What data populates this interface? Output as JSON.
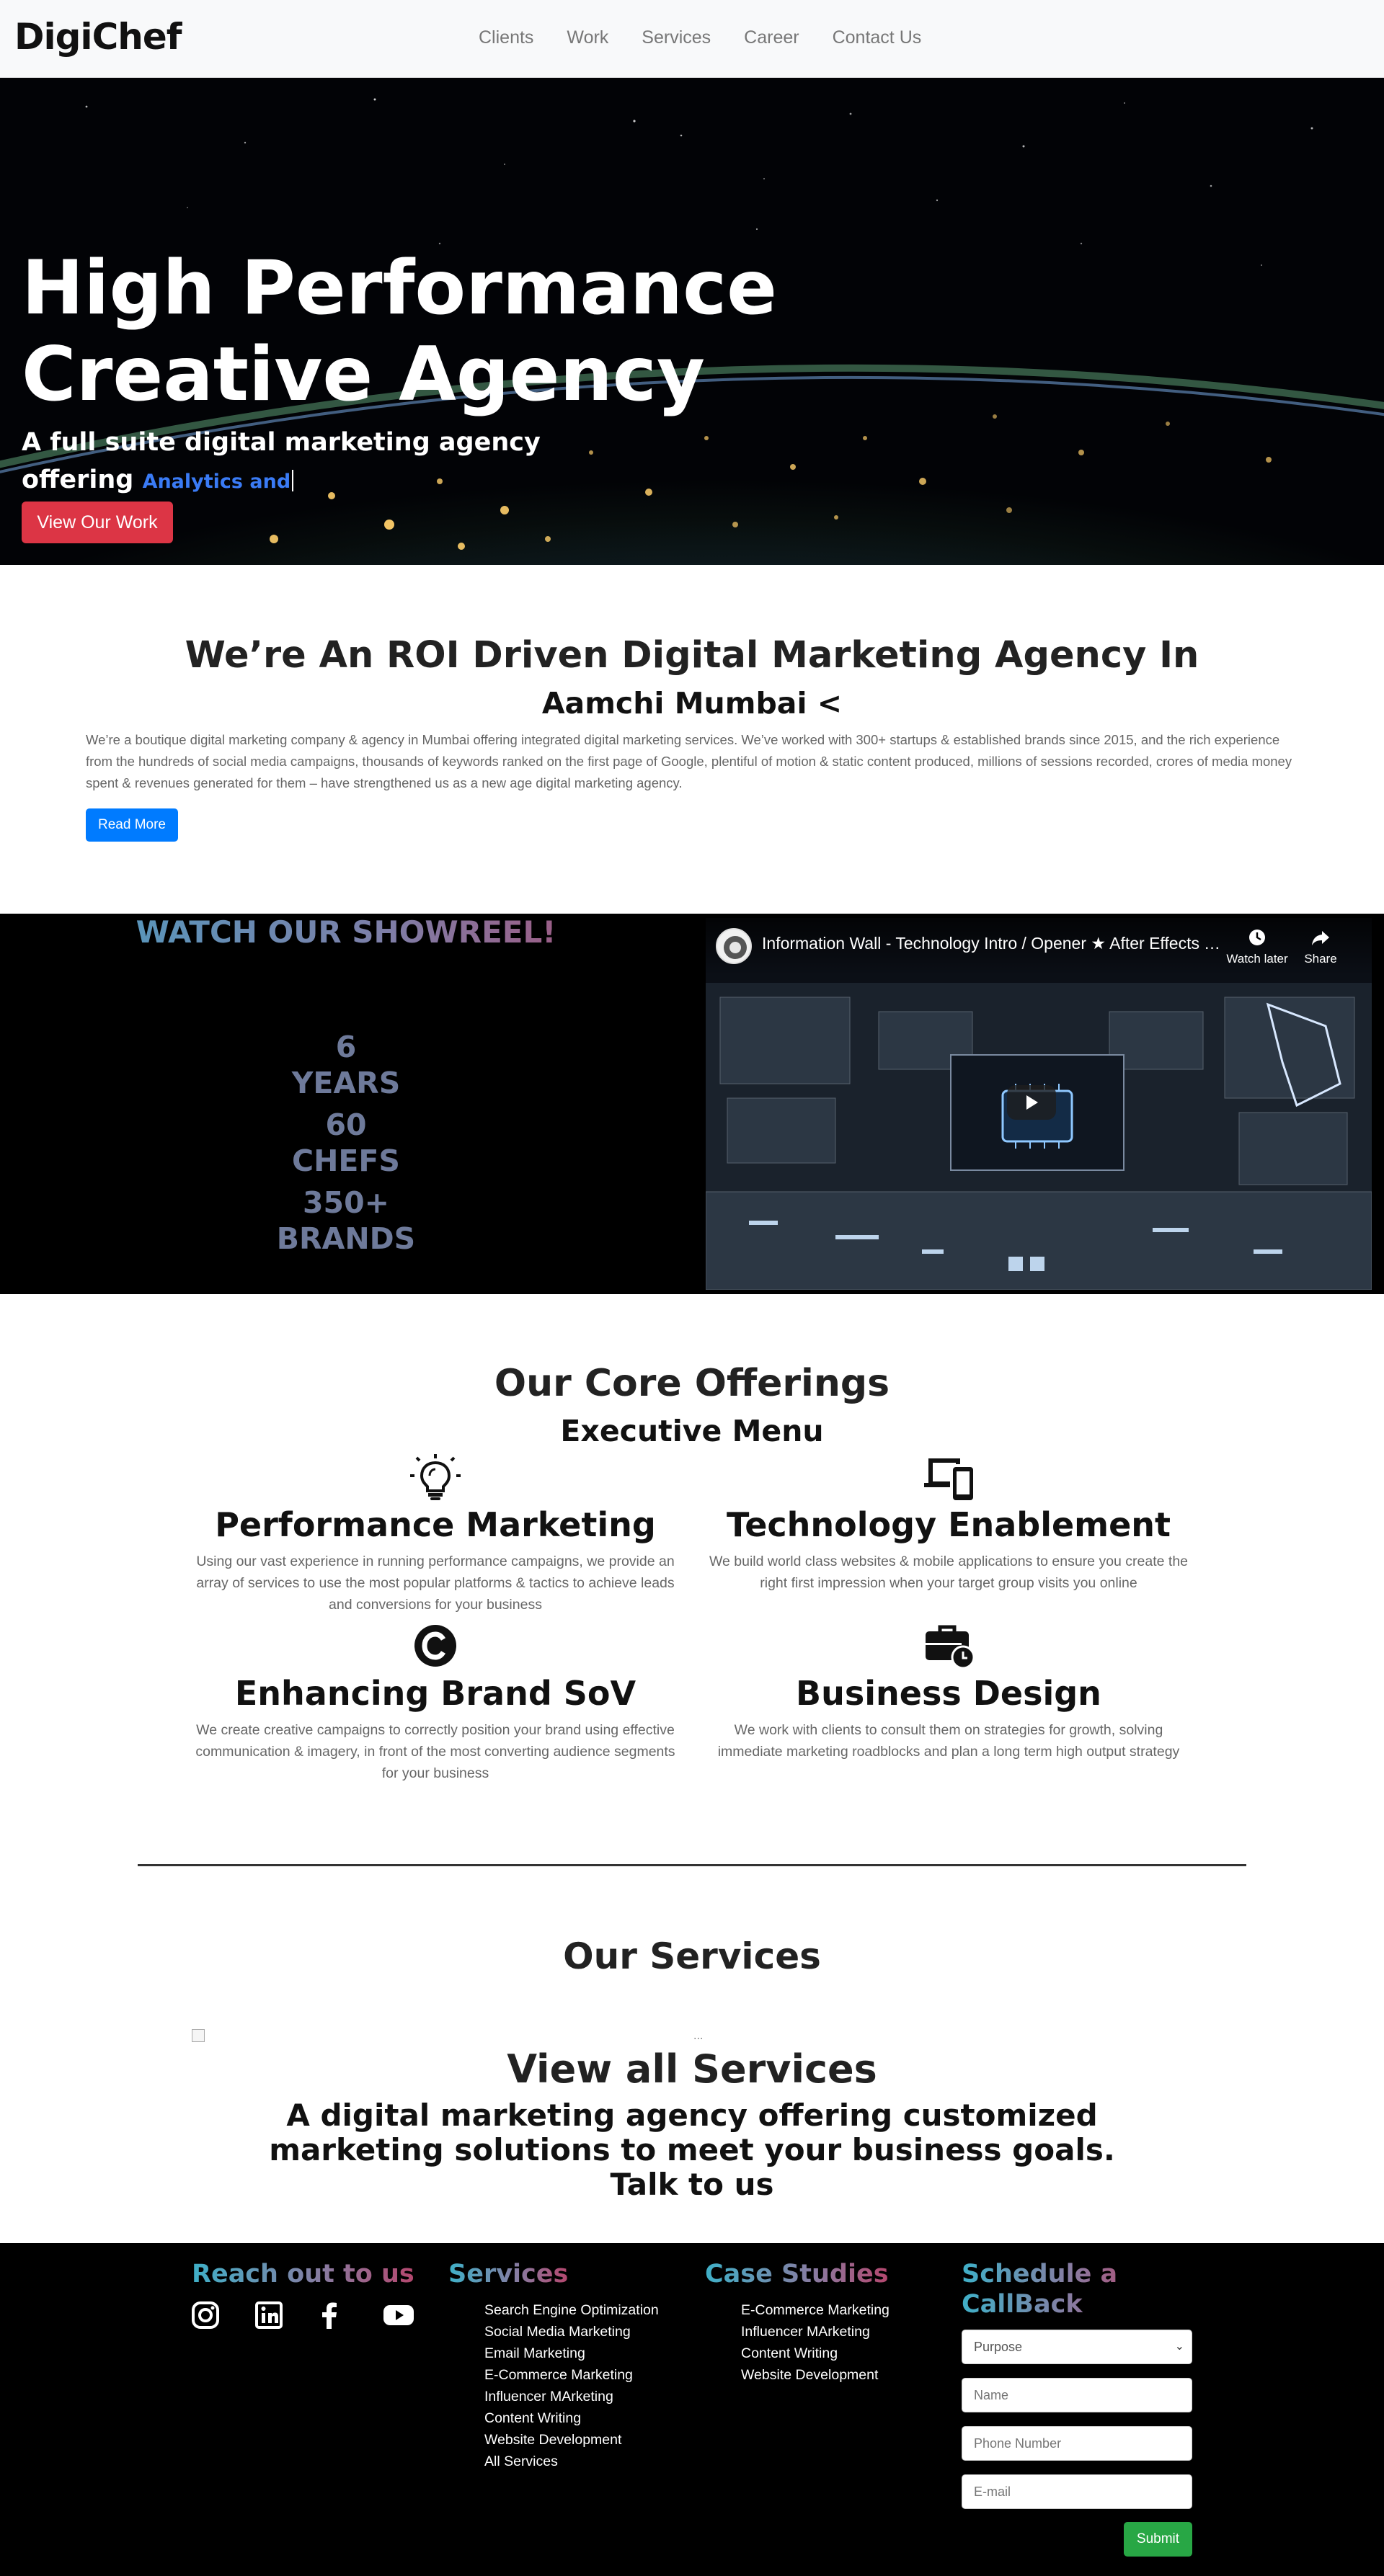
{
  "navbar": {
    "brand": "DigiChef",
    "links": [
      "Clients",
      "Work",
      "Services",
      "Career",
      "Contact Us"
    ]
  },
  "hero": {
    "title_line1": "High Performance",
    "title_line2": "Creative Agency",
    "subtitle_line1": "A full suite digital marketing agency",
    "subtitle_line2": "offering",
    "typed_text": "Analytics and",
    "cta": "View Our Work"
  },
  "roi": {
    "heading": "We’re An ROI Driven Digital Marketing Agency In",
    "subheading": "Aamchi Mumbai <",
    "body": "We’re a boutique digital marketing company & agency in Mumbai offering integrated digital marketing services. We’ve worked with 300+ startups & established brands since 2015, and the rich experience from the hundreds of social media campaigns, thousands of keywords ranked on the first page of Google, plentiful of motion & static content produced, millions of sessions recorded, crores of media money spent & revenues generated for them – have strengthened us as a new age digital marketing agency.",
    "button": "Read More"
  },
  "showreel": {
    "title": "WATCH OUR SHOWREEL!",
    "stats": [
      {
        "number": "6",
        "label": "YEARS"
      },
      {
        "number": "60",
        "label": "CHEFS"
      },
      {
        "number": "350+",
        "label": "BRANDS"
      }
    ],
    "video": {
      "title": "Information Wall - Technology Intro / Opener ★ After Effects T...",
      "watch_later": "Watch later",
      "share": "Share"
    }
  },
  "core": {
    "heading": "Our Core Offerings",
    "subheading": "Executive Menu",
    "offerings": [
      {
        "icon": "lightbulb-icon",
        "title": "Performance Marketing",
        "desc": "Using our vast experience in running performance campaigns, we provide an array of services to use the most popular platforms & tactics to achieve leads and conversions for your business"
      },
      {
        "icon": "devices-icon",
        "title": "Technology Enablement",
        "desc": "We build world class websites & mobile applications to ensure you create the right first impression when your target group visits you online"
      },
      {
        "icon": "copyright-icon",
        "title": "Enhancing Brand SoV",
        "desc": "We create creative campaigns to correctly position your brand using effective communication & imagery, in front of the most converting audience segments for your business"
      },
      {
        "icon": "business-time-icon",
        "title": "Business Design",
        "desc": "We work with clients to consult them on strategies for growth, solving immediate marketing roadblocks and plan a long term high output strategy"
      }
    ]
  },
  "services": {
    "heading": "Our Services",
    "dots": "...",
    "view_all": "View all Services",
    "tagline": "A digital marketing agency offering customized marketing solutions to meet your business goals. Talk to us"
  },
  "footer": {
    "reach_heading": "Reach out to us",
    "services_heading": "Services",
    "services_list": [
      "Search Engine Optimization",
      "Social Media Marketing",
      "Email Marketing",
      "E-Commerce Marketing",
      "Influencer MArketing",
      "Content Writing",
      "Website Development",
      "All Services"
    ],
    "cases_heading": "Case Studies",
    "cases_list": [
      "E-Commerce Marketing",
      "Influencer MArketing",
      "Content Writing",
      "Website Development"
    ],
    "callback_heading": "Schedule a CallBack",
    "form": {
      "purpose": "Purpose",
      "name_placeholder": "Name",
      "phone_placeholder": "Phone Number",
      "email_placeholder": "E-mail",
      "submit": "Submit"
    }
  },
  "colors": {
    "accent_red": "#dc3545",
    "accent_blue": "#007bff",
    "accent_green": "#28a745",
    "stat_color": "#6e7a9a"
  }
}
